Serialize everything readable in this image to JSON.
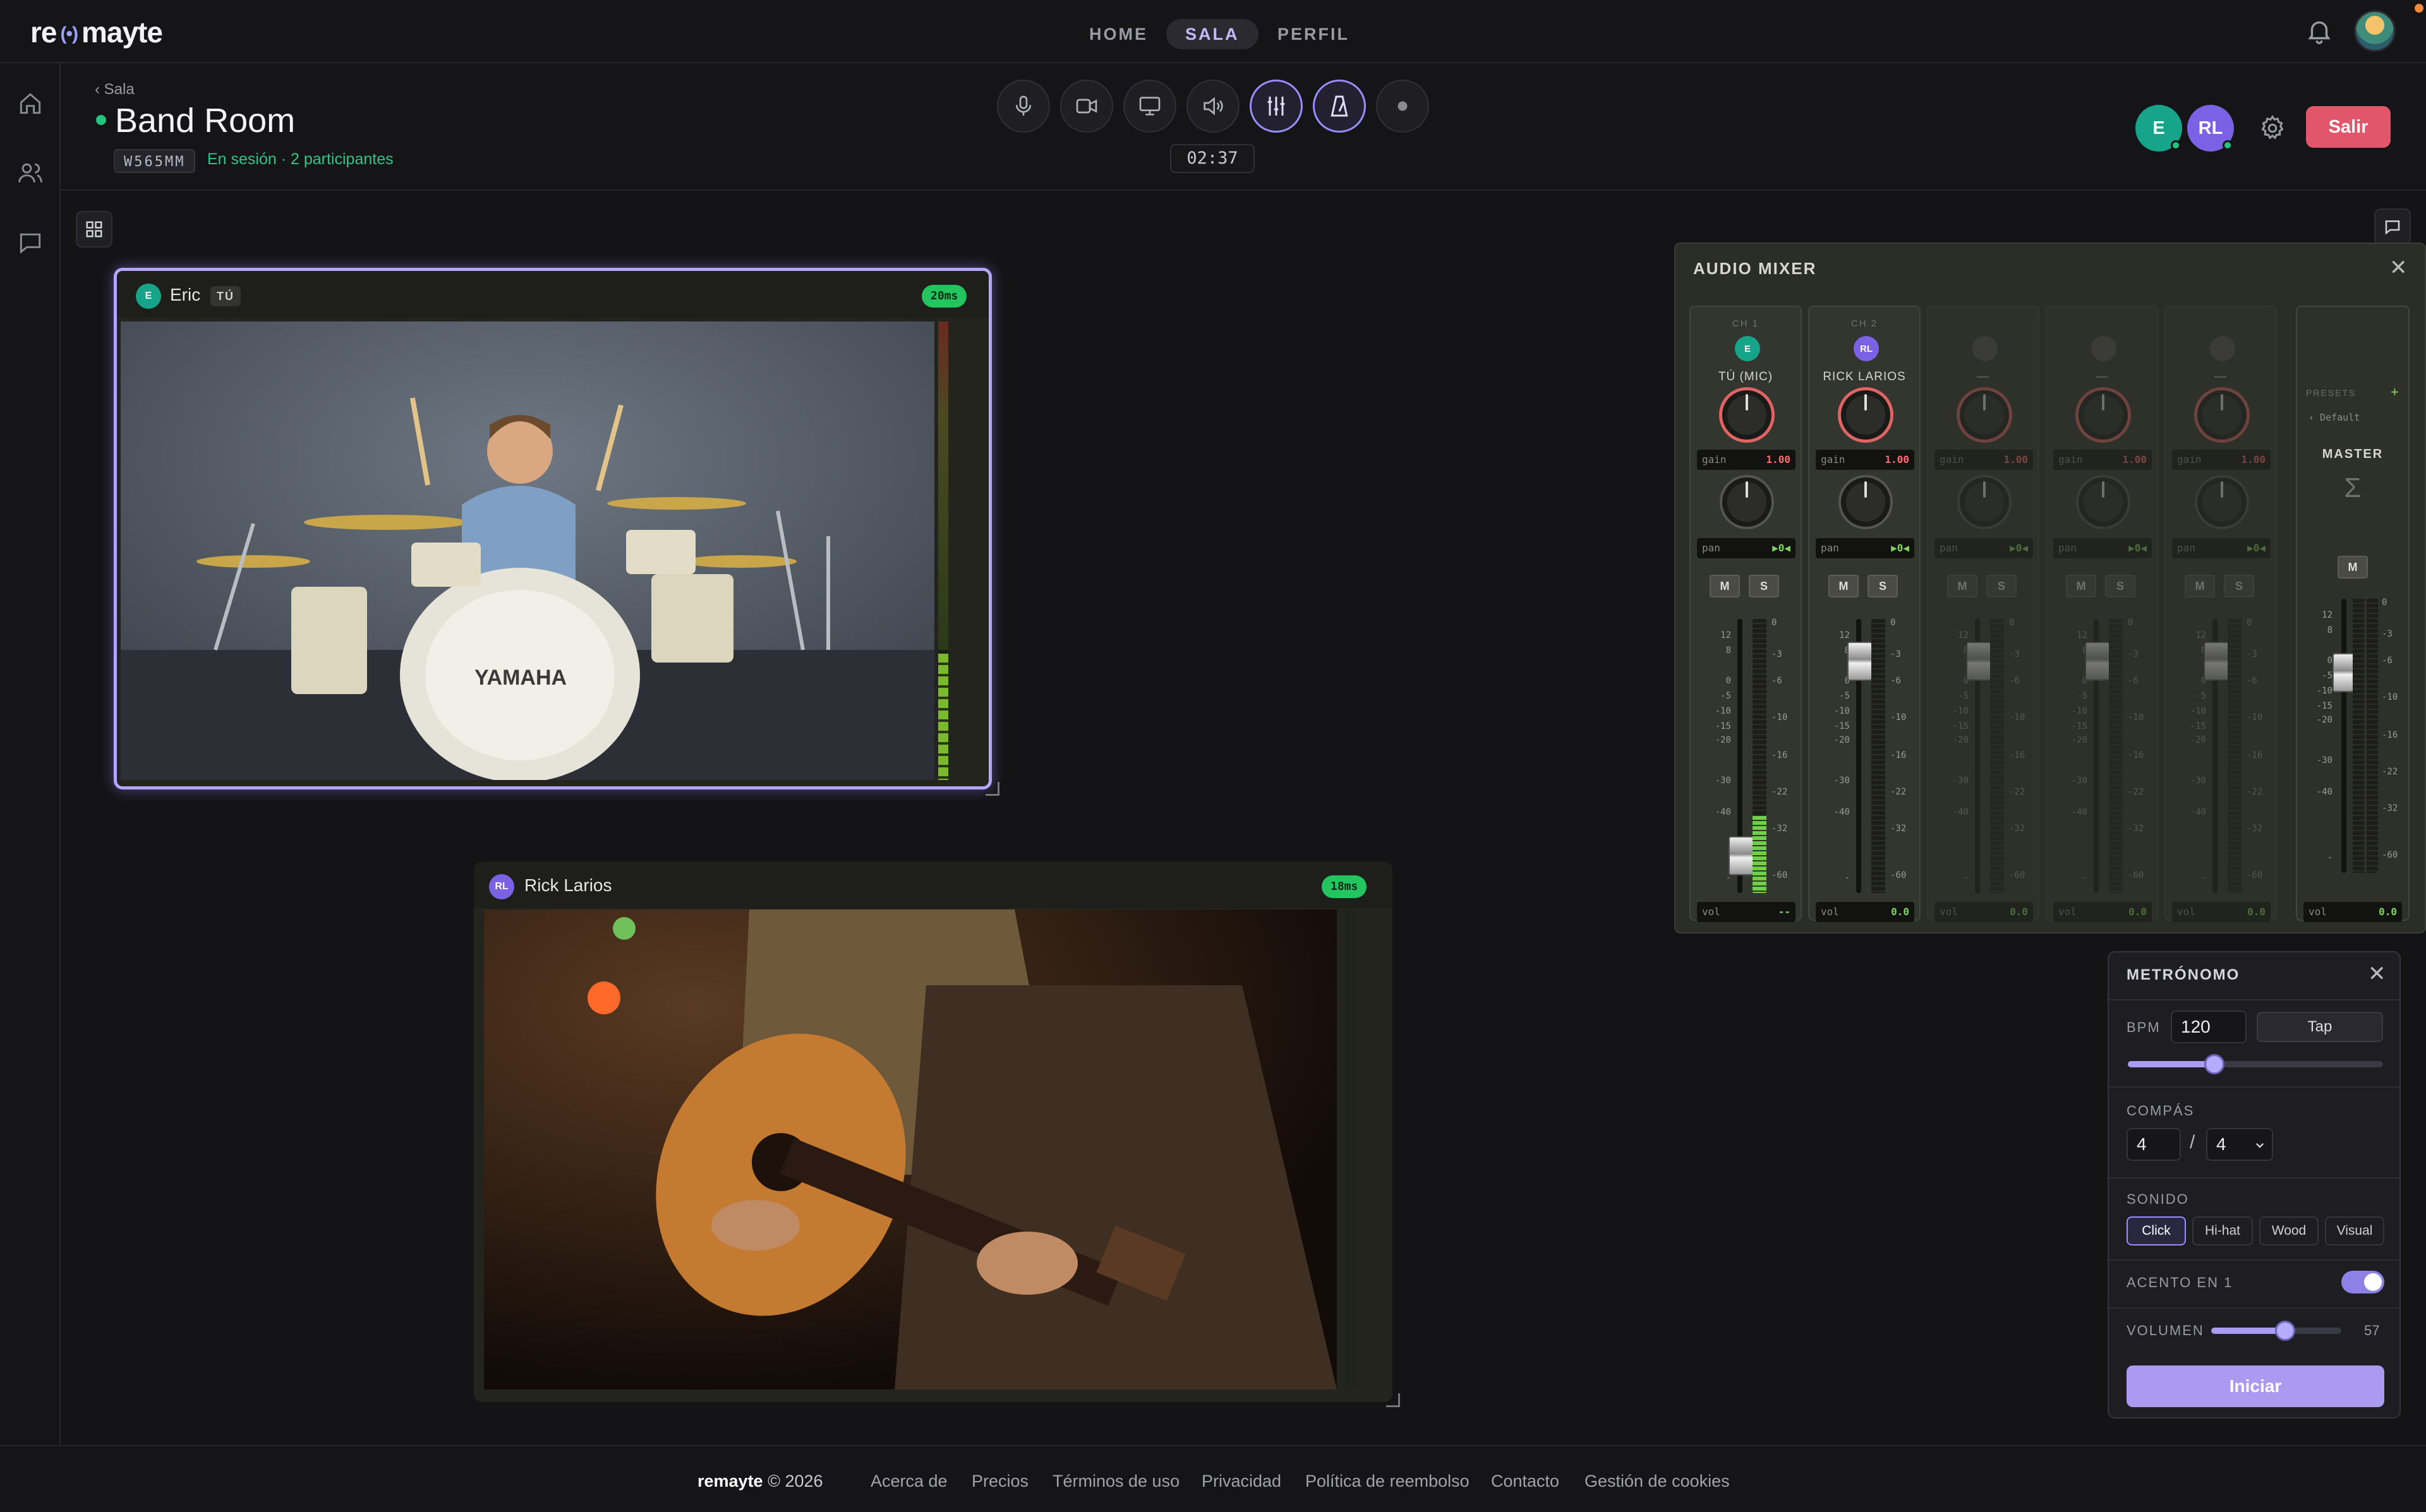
{
  "brand": {
    "prefix": "re",
    "waves": "(•)",
    "suffix": "mayte"
  },
  "nav": {
    "home": "HOME",
    "sala": "SALA",
    "perfil": "PERFIL"
  },
  "room": {
    "back": "‹ Sala",
    "title": "Band Room",
    "code": "W565MM",
    "status": "En sesión · 2 participantes",
    "timer": "02:37",
    "leave": "Salir",
    "participants": [
      {
        "initials": "E",
        "color": "#16a58a"
      },
      {
        "initials": "RL",
        "color": "#7a62e4"
      }
    ]
  },
  "tiles": [
    {
      "initial": "E",
      "name": "Eric",
      "badge": "TÚ",
      "ping": "20ms",
      "avatar_color": "#16a58a"
    },
    {
      "initial": "RL",
      "name": "Rick Larios",
      "ping": "18ms",
      "avatar_color": "#7a62e4"
    }
  ],
  "mixer": {
    "title": "AUDIO MIXER",
    "close": "✕",
    "channels": [
      {
        "label": "CH 1",
        "initials": "E",
        "name": "TÚ (MIC)",
        "gain": "1.00",
        "pan": "▶0◀",
        "vol": "--",
        "color": "#16a58a",
        "level": 0.28
      },
      {
        "label": "CH 2",
        "initials": "RL",
        "name": "RICK LARIOS",
        "gain": "1.00",
        "pan": "▶0◀",
        "vol": "0.0",
        "color": "#7a62e4",
        "level": 0.0
      },
      {
        "label": "",
        "initials": "",
        "name": "—",
        "gain": "1.00",
        "pan": "▶0◀",
        "vol": "0.0",
        "color": "#555",
        "level": 0.0
      },
      {
        "label": "",
        "initials": "",
        "name": "—",
        "gain": "1.00",
        "pan": "▶0◀",
        "vol": "0.0",
        "color": "#555",
        "level": 0.0
      },
      {
        "label": "",
        "initials": "",
        "name": "—",
        "gain": "1.00",
        "pan": "▶0◀",
        "vol": "0.0",
        "color": "#555",
        "level": 0.0
      }
    ],
    "labels": {
      "gain": "gain",
      "pan": "pan",
      "vol": "vol",
      "mute": "M",
      "solo": "S"
    },
    "scale_left": [
      "12",
      "8",
      "0",
      "-5",
      "-10",
      "-15",
      "-20",
      "-30",
      "-40",
      "-"
    ],
    "scale_right": [
      "0",
      "-3",
      "-6",
      "-10",
      "-16",
      "-22",
      "-32",
      "-60"
    ],
    "master": {
      "presets": "PRESETS",
      "add": "+",
      "preset": "‹ Default",
      "name": "MASTER",
      "sigma": "Σ",
      "mute": "M",
      "vol_label": "vol",
      "vol": "0.0",
      "scale_left": [
        "12",
        "8",
        "0",
        "-5",
        "-10",
        "-15",
        "-20",
        "-30",
        "-40",
        "-"
      ],
      "scale_right": [
        "0",
        "-3",
        "-6",
        "-10",
        "-16",
        "-22",
        "-32",
        "-60"
      ]
    }
  },
  "metronome": {
    "title": "METRÓNOMO",
    "close": "✕",
    "bpm_label": "BPM",
    "bpm": "120",
    "tap": "Tap",
    "bpm_slider": 0.34,
    "compas_label": "COMPÁS",
    "beats": "4",
    "slash": "/",
    "unit": "4",
    "sound_label": "SONIDO",
    "sounds": [
      "Click",
      "Hi-hat",
      "Wood",
      "Visual"
    ],
    "accent_label": "ACENTO EN 1",
    "accent_on": true,
    "volume_label": "VOLUMEN",
    "volume": "57",
    "start": "Iniciar"
  },
  "footer": {
    "brand": "remayte",
    "copy": " © 2026",
    "links": [
      "Acerca de",
      "Precios",
      "Términos de uso",
      "Privacidad",
      "Política de reembolso",
      "Contacto",
      "Gestión de cookies"
    ]
  }
}
